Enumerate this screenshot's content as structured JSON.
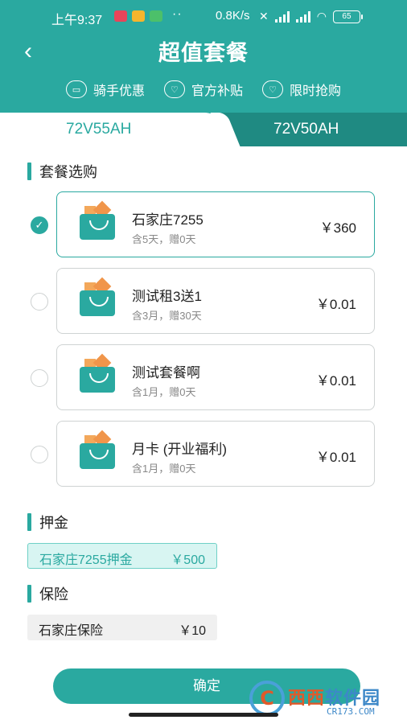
{
  "status_bar": {
    "time": "上午9:37",
    "dots": "··",
    "speed": "0.8K/s",
    "battery": "65"
  },
  "header": {
    "title": "超值套餐",
    "perks": [
      {
        "label": "骑手优惠",
        "icon": "ticket-icon"
      },
      {
        "label": "官方补贴",
        "icon": "heart-icon"
      },
      {
        "label": "限时抢购",
        "icon": "heart-icon"
      }
    ]
  },
  "tabs": [
    {
      "label": "72V55AH",
      "active": true
    },
    {
      "label": "72V50AH",
      "active": false
    }
  ],
  "package_section": {
    "title": "套餐选购",
    "packages": [
      {
        "name": "石家庄7255",
        "subtitle": "含5天，赠0天",
        "price": "￥360",
        "selected": true
      },
      {
        "name": "测试租3送1",
        "subtitle": "含3月，赠30天",
        "price": "￥0.01",
        "selected": false
      },
      {
        "name": "测试套餐啊",
        "subtitle": "含1月，赠0天",
        "price": "￥0.01",
        "selected": false
      },
      {
        "name": "月卡 (开业福利)",
        "subtitle": "含1月，赠0天",
        "price": "￥0.01",
        "selected": false
      }
    ]
  },
  "deposit_section": {
    "title": "押金",
    "item": {
      "name": "石家庄7255押金",
      "price": "￥500"
    }
  },
  "insurance_section": {
    "title": "保险",
    "item": {
      "name": "石家庄保险",
      "price": "￥10"
    }
  },
  "confirm_label": "确定",
  "watermark": {
    "logo": "C",
    "text_a": "西西",
    "text_b": "软件园",
    "url": "CR173.COM"
  },
  "colors": {
    "accent": "#2aa9a0",
    "accent_dark": "#1f8a82",
    "deposit_bg": "#d8f5f2"
  }
}
